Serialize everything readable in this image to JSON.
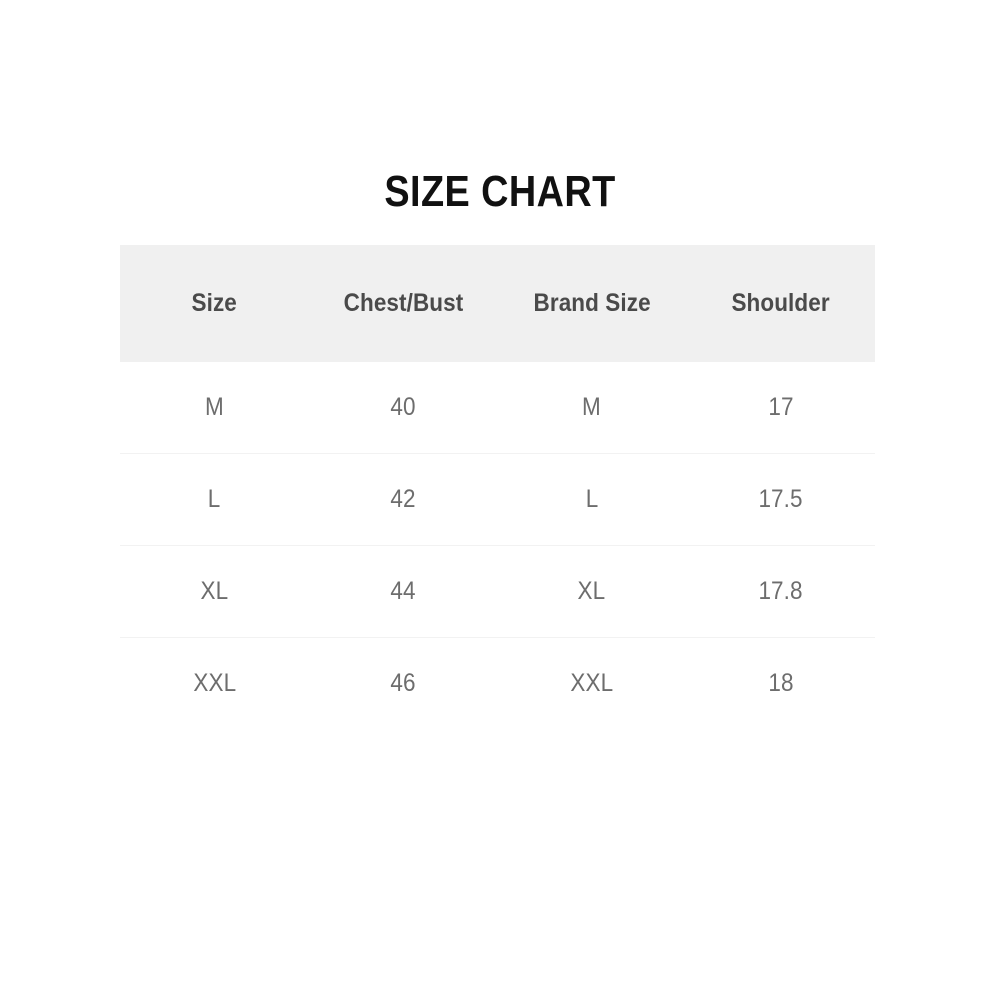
{
  "title": "SIZE CHART",
  "colors": {
    "page_background": "#ffffff",
    "title_text": "#111111",
    "header_background": "#f0f0f0",
    "header_text": "#4a4a4a",
    "body_text": "#6d6d6d",
    "row_divider": "#f2f2f2"
  },
  "chart_data": {
    "type": "table",
    "title": "SIZE CHART",
    "columns": [
      "Size",
      "Chest/Bust",
      "Brand Size",
      "Shoulder"
    ],
    "rows": [
      [
        "M",
        "40",
        "M",
        "17"
      ],
      [
        "L",
        "42",
        "L",
        "17.5"
      ],
      [
        "XL",
        "44",
        "XL",
        "17.8"
      ],
      [
        "XXL",
        "46",
        "XXL",
        "18"
      ]
    ]
  }
}
